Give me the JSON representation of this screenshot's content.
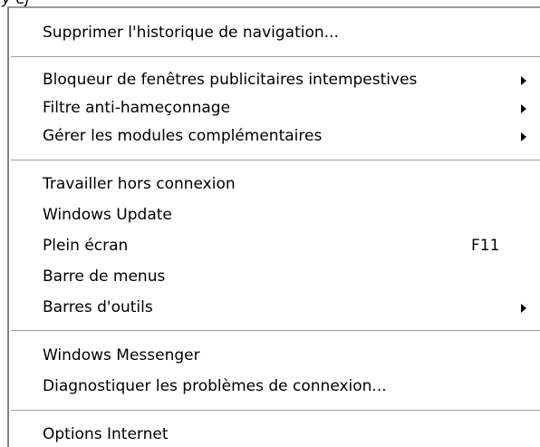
{
  "menu_fragment_top": "y ej",
  "menu": {
    "items": [
      {
        "label": "Supprimer l'historique de navigation..."
      },
      {
        "label": "Bloqueur de fenêtres publicitaires intempestives"
      },
      {
        "label": "Filtre anti-hameçonnage"
      },
      {
        "label": "Gérer les modules complémentaires"
      },
      {
        "label": "Travailler hors connexion"
      },
      {
        "label": "Windows Update"
      },
      {
        "label": "Plein écran",
        "shortcut": "F11"
      },
      {
        "label": "Barre de menus"
      },
      {
        "label": "Barres d'outils"
      },
      {
        "label": "Windows Messenger"
      },
      {
        "label": "Diagnostiquer les problèmes de connexion..."
      },
      {
        "label": "Options Internet"
      }
    ],
    "icons": {
      "submenu": "submenu-arrow-icon"
    }
  }
}
